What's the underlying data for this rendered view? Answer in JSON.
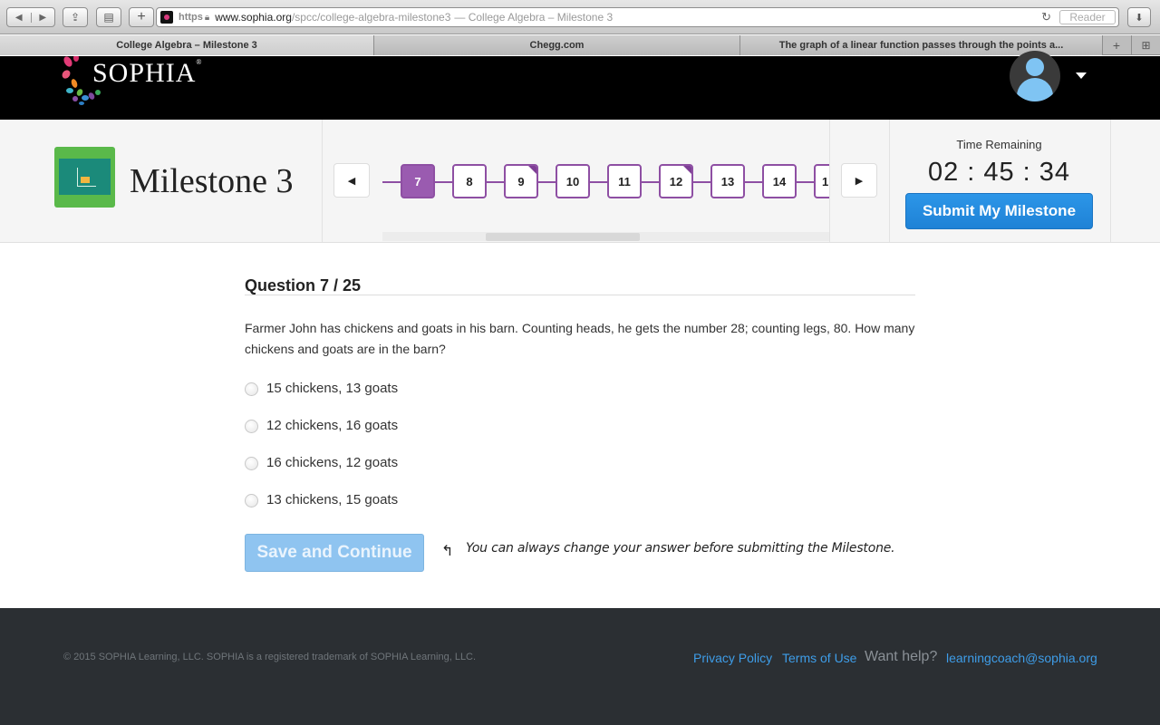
{
  "browser": {
    "https_label": "https",
    "url_domain": "www.sophia.org",
    "url_path": "/spcc/college-algebra-milestone3",
    "url_title": "— College Algebra – Milestone 3",
    "reader_label": "Reader",
    "tabs": [
      {
        "label": "College Algebra – Milestone 3",
        "active": true
      },
      {
        "label": "Chegg.com",
        "active": false
      },
      {
        "label": "The graph of a linear function passes through the points a...",
        "active": false
      }
    ]
  },
  "header": {
    "logo_text": "SOPHIA",
    "logo_mark": "®"
  },
  "milestone": {
    "title": "Milestone 3",
    "question_numbers": [
      "7",
      "8",
      "9",
      "10",
      "11",
      "12",
      "13",
      "14",
      "1"
    ],
    "current_question": "7",
    "answered_questions": [
      "9",
      "12"
    ],
    "timer_label": "Time Remaining",
    "timer_value": "02 : 45 : 34",
    "submit_label": "Submit My Milestone"
  },
  "question": {
    "heading": "Question 7 / 25",
    "text": "Farmer John has chickens and goats in his barn. Counting heads, he gets the number 28; counting legs, 80. How many chickens and goats are in the barn?",
    "options": [
      "15 chickens, 13 goats",
      "12 chickens, 16 goats",
      "16 chickens, 12 goats",
      "13 chickens, 15 goats"
    ],
    "save_label": "Save and Continue",
    "hint": "You can always change your answer before submitting the Milestone."
  },
  "footer": {
    "copyright": "© 2015 SOPHIA Learning, LLC. SOPHIA is a registered trademark of SOPHIA Learning, LLC.",
    "privacy": "Privacy Policy",
    "terms": "Terms of Use",
    "want_help": "Want help?",
    "email": "learningcoach@sophia.org"
  },
  "colors": {
    "accent_purple": "#8e4fa3",
    "submit_blue": "#1f82d6",
    "footer_bg": "#2b2f33",
    "link_blue": "#3e9de8"
  }
}
